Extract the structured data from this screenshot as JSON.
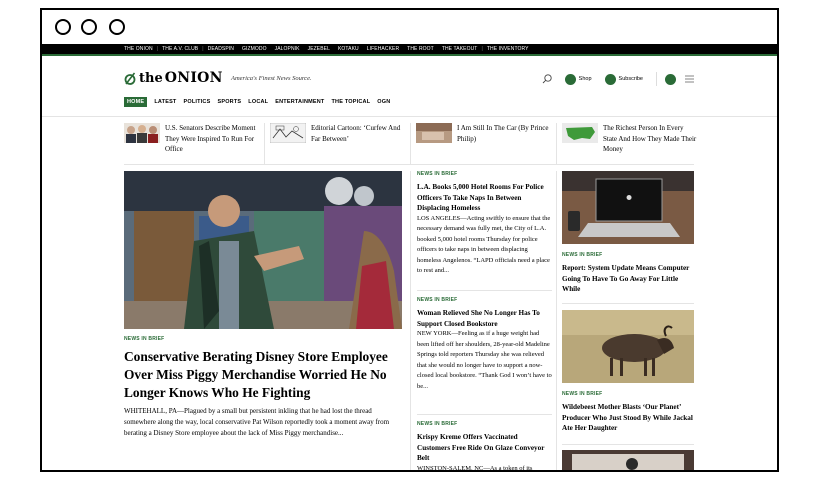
{
  "topnav": [
    "THE ONION",
    "THE A.V. CLUB",
    "DEADSPIN",
    "GIZMODO",
    "JALOPNIK",
    "JEZEBEL",
    "KOTAKU",
    "LIFEHACKER",
    "THE ROOT",
    "THE TAKEOUT",
    "THE INVENTORY"
  ],
  "header": {
    "logo_the": "the",
    "logo_onion": "ONION",
    "tagline": "America's Finest News Source.",
    "shop_label": "Shop",
    "subscribe_label": "Subscribe"
  },
  "mainnav": [
    "HOME",
    "LATEST",
    "POLITICS",
    "SPORTS",
    "LOCAL",
    "ENTERTAINMENT",
    "THE TOPICAL",
    "OGN"
  ],
  "strip": [
    {
      "text": "U.S. Senators Describe Moment They Were Inspired To Run For Office"
    },
    {
      "text": "Editorial Cartoon: ‘Curfew And Far Between’"
    },
    {
      "text": "I Am Still In The Car (By Prince Philip)"
    },
    {
      "text": "The Richest Person In Every State And How They Made Their Money"
    }
  ],
  "hero": {
    "kicker": "NEWS IN BRIEF",
    "title": "Conservative Berating Disney Store Employee Over Miss Piggy Merchandise Worried He No Longer Knows Who He Fighting",
    "body": "WHITEHALL, PA—Plagued by a small but persistent inkling that he had lost the thread somewhere along the way, local conservative Pat Wilson reportedly took a moment away from berating a Disney Store employee about the lack of Miss Piggy merchandise..."
  },
  "col2": [
    {
      "kicker": "NEWS IN BRIEF",
      "title": "L.A. Books 5,000 Hotel Rooms For Police Officers To Take Naps In Between Displacing Homeless",
      "body": "LOS ANGELES—Acting swiftly to ensure that the necessary demand was fully met, the City of L.A. booked 5,000 hotel rooms Thursday for police officers to take naps in between displacing homeless Angelenos. “LAPD officials need a place to rest and..."
    },
    {
      "kicker": "NEWS IN BRIEF",
      "title": "Woman Relieved She No Longer Has To Support Closed Bookstore",
      "body": "NEW YORK—Feeling as if a huge weight had been lifted off her shoulders, 28-year-old Madeline Springs told reporters Thursday she was relieved that she would no longer have to support a now-closed local bookstore. “Thank God I won’t have to be..."
    },
    {
      "kicker": "NEWS IN BRIEF",
      "title": "Krispy Kreme Offers Vaccinated Customers Free Ride On Glaze Conveyor Belt",
      "body": "WINSTON-SALEM, NC—As a token of its"
    }
  ],
  "col3": [
    {
      "kicker": "NEWS IN BRIEF",
      "title": "Report: System Update Means Computer Going To Have To Go Away For Little While"
    },
    {
      "kicker": "NEWS IN BRIEF",
      "title": "Wildebeest Mother Blasts ‘Our Planet’ Producer Who Just Stood By While Jackal Ate Her Daughter"
    }
  ]
}
